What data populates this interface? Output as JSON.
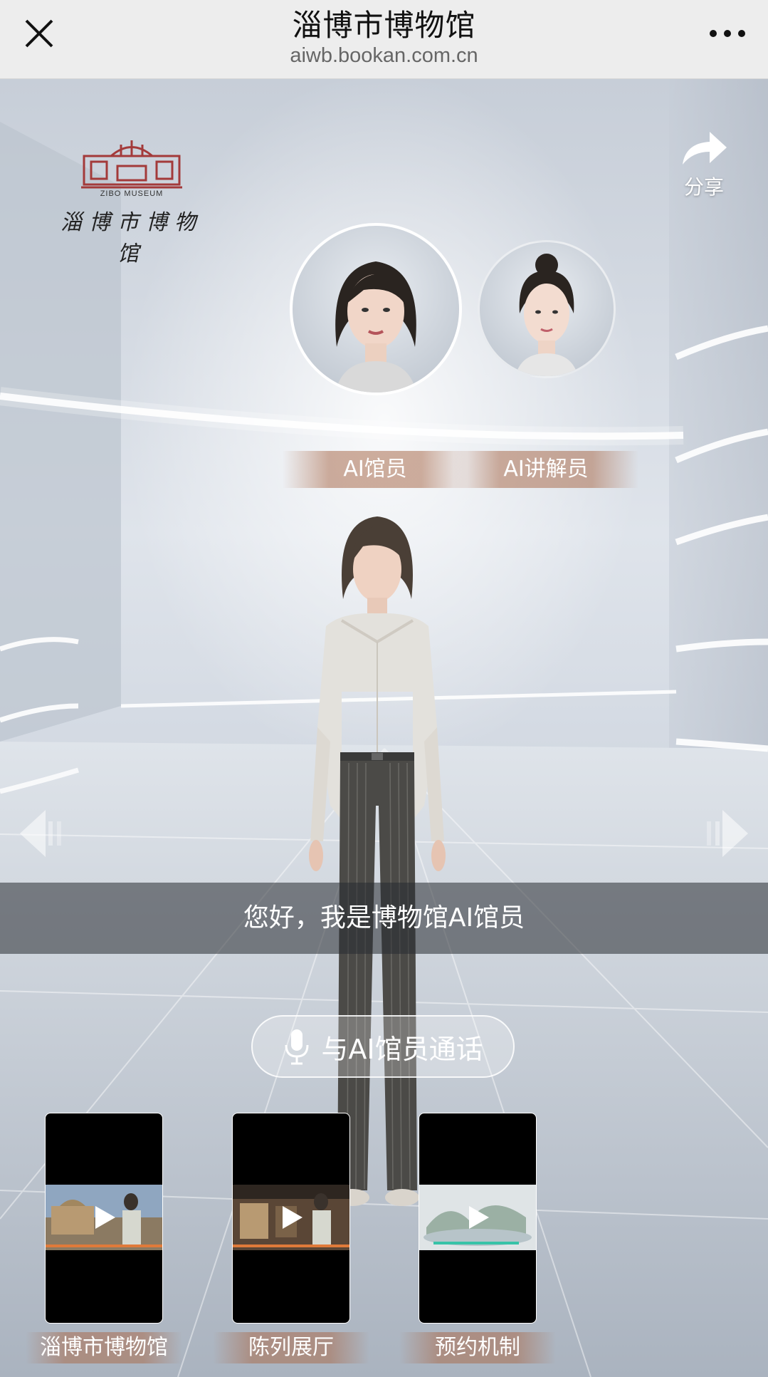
{
  "browser": {
    "title": "淄博市博物馆",
    "url": "aiwb.bookan.com.cn"
  },
  "logo": {
    "english": "ZIBO MUSEUM",
    "chinese": "淄博市博物馆",
    "color": "#a33a3a"
  },
  "share": {
    "label": "分享",
    "icon": "share-arrow-icon"
  },
  "avatars": [
    {
      "label": "AI馆员",
      "selected": true
    },
    {
      "label": "AI讲解员",
      "selected": false
    }
  ],
  "subtitle": "您好，我是博物馆AI馆员",
  "call_button": {
    "label": "与AI馆员通话",
    "icon": "microphone-icon"
  },
  "videos": [
    {
      "label": "淄博市博物馆",
      "icon": "play-icon"
    },
    {
      "label": "陈列展厅",
      "icon": "play-icon"
    },
    {
      "label": "预约机制",
      "icon": "play-icon"
    }
  ],
  "colors": {
    "accent_label_bg": "#aa6e50",
    "topbar_bg": "#ededed"
  }
}
